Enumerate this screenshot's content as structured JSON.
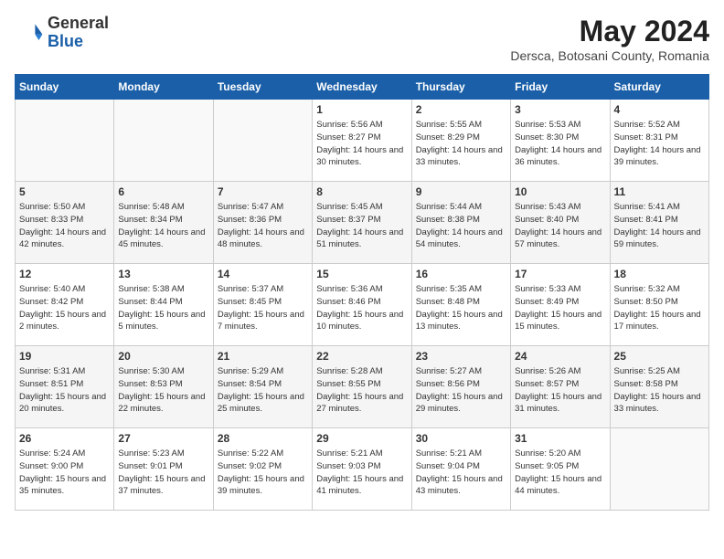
{
  "header": {
    "logo_general": "General",
    "logo_blue": "Blue",
    "month_year": "May 2024",
    "location": "Dersca, Botosani County, Romania"
  },
  "weekdays": [
    "Sunday",
    "Monday",
    "Tuesday",
    "Wednesday",
    "Thursday",
    "Friday",
    "Saturday"
  ],
  "weeks": [
    [
      {
        "day": "",
        "info": ""
      },
      {
        "day": "",
        "info": ""
      },
      {
        "day": "",
        "info": ""
      },
      {
        "day": "1",
        "info": "Sunrise: 5:56 AM\nSunset: 8:27 PM\nDaylight: 14 hours\nand 30 minutes."
      },
      {
        "day": "2",
        "info": "Sunrise: 5:55 AM\nSunset: 8:29 PM\nDaylight: 14 hours\nand 33 minutes."
      },
      {
        "day": "3",
        "info": "Sunrise: 5:53 AM\nSunset: 8:30 PM\nDaylight: 14 hours\nand 36 minutes."
      },
      {
        "day": "4",
        "info": "Sunrise: 5:52 AM\nSunset: 8:31 PM\nDaylight: 14 hours\nand 39 minutes."
      }
    ],
    [
      {
        "day": "5",
        "info": "Sunrise: 5:50 AM\nSunset: 8:33 PM\nDaylight: 14 hours\nand 42 minutes."
      },
      {
        "day": "6",
        "info": "Sunrise: 5:48 AM\nSunset: 8:34 PM\nDaylight: 14 hours\nand 45 minutes."
      },
      {
        "day": "7",
        "info": "Sunrise: 5:47 AM\nSunset: 8:36 PM\nDaylight: 14 hours\nand 48 minutes."
      },
      {
        "day": "8",
        "info": "Sunrise: 5:45 AM\nSunset: 8:37 PM\nDaylight: 14 hours\nand 51 minutes."
      },
      {
        "day": "9",
        "info": "Sunrise: 5:44 AM\nSunset: 8:38 PM\nDaylight: 14 hours\nand 54 minutes."
      },
      {
        "day": "10",
        "info": "Sunrise: 5:43 AM\nSunset: 8:40 PM\nDaylight: 14 hours\nand 57 minutes."
      },
      {
        "day": "11",
        "info": "Sunrise: 5:41 AM\nSunset: 8:41 PM\nDaylight: 14 hours\nand 59 minutes."
      }
    ],
    [
      {
        "day": "12",
        "info": "Sunrise: 5:40 AM\nSunset: 8:42 PM\nDaylight: 15 hours\nand 2 minutes."
      },
      {
        "day": "13",
        "info": "Sunrise: 5:38 AM\nSunset: 8:44 PM\nDaylight: 15 hours\nand 5 minutes."
      },
      {
        "day": "14",
        "info": "Sunrise: 5:37 AM\nSunset: 8:45 PM\nDaylight: 15 hours\nand 7 minutes."
      },
      {
        "day": "15",
        "info": "Sunrise: 5:36 AM\nSunset: 8:46 PM\nDaylight: 15 hours\nand 10 minutes."
      },
      {
        "day": "16",
        "info": "Sunrise: 5:35 AM\nSunset: 8:48 PM\nDaylight: 15 hours\nand 13 minutes."
      },
      {
        "day": "17",
        "info": "Sunrise: 5:33 AM\nSunset: 8:49 PM\nDaylight: 15 hours\nand 15 minutes."
      },
      {
        "day": "18",
        "info": "Sunrise: 5:32 AM\nSunset: 8:50 PM\nDaylight: 15 hours\nand 17 minutes."
      }
    ],
    [
      {
        "day": "19",
        "info": "Sunrise: 5:31 AM\nSunset: 8:51 PM\nDaylight: 15 hours\nand 20 minutes."
      },
      {
        "day": "20",
        "info": "Sunrise: 5:30 AM\nSunset: 8:53 PM\nDaylight: 15 hours\nand 22 minutes."
      },
      {
        "day": "21",
        "info": "Sunrise: 5:29 AM\nSunset: 8:54 PM\nDaylight: 15 hours\nand 25 minutes."
      },
      {
        "day": "22",
        "info": "Sunrise: 5:28 AM\nSunset: 8:55 PM\nDaylight: 15 hours\nand 27 minutes."
      },
      {
        "day": "23",
        "info": "Sunrise: 5:27 AM\nSunset: 8:56 PM\nDaylight: 15 hours\nand 29 minutes."
      },
      {
        "day": "24",
        "info": "Sunrise: 5:26 AM\nSunset: 8:57 PM\nDaylight: 15 hours\nand 31 minutes."
      },
      {
        "day": "25",
        "info": "Sunrise: 5:25 AM\nSunset: 8:58 PM\nDaylight: 15 hours\nand 33 minutes."
      }
    ],
    [
      {
        "day": "26",
        "info": "Sunrise: 5:24 AM\nSunset: 9:00 PM\nDaylight: 15 hours\nand 35 minutes."
      },
      {
        "day": "27",
        "info": "Sunrise: 5:23 AM\nSunset: 9:01 PM\nDaylight: 15 hours\nand 37 minutes."
      },
      {
        "day": "28",
        "info": "Sunrise: 5:22 AM\nSunset: 9:02 PM\nDaylight: 15 hours\nand 39 minutes."
      },
      {
        "day": "29",
        "info": "Sunrise: 5:21 AM\nSunset: 9:03 PM\nDaylight: 15 hours\nand 41 minutes."
      },
      {
        "day": "30",
        "info": "Sunrise: 5:21 AM\nSunset: 9:04 PM\nDaylight: 15 hours\nand 43 minutes."
      },
      {
        "day": "31",
        "info": "Sunrise: 5:20 AM\nSunset: 9:05 PM\nDaylight: 15 hours\nand 44 minutes."
      },
      {
        "day": "",
        "info": ""
      }
    ]
  ]
}
